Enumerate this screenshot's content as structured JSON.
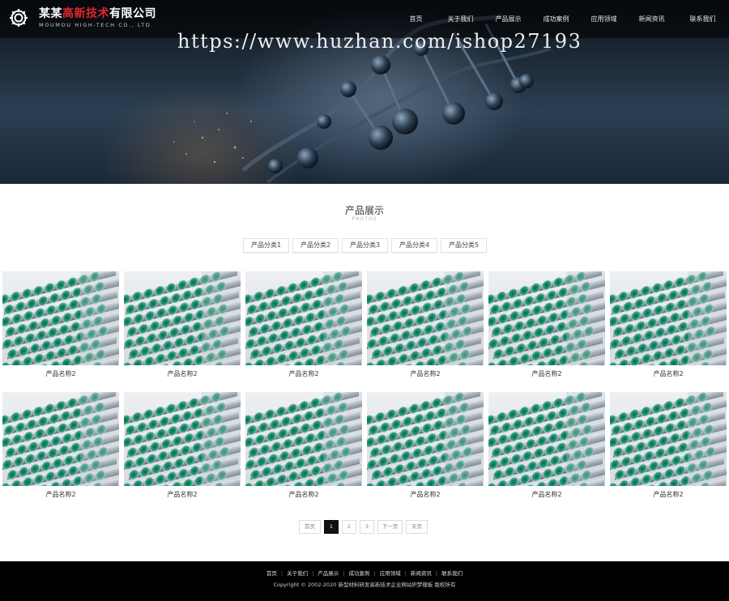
{
  "brand": {
    "name_prefix": "某某",
    "name_highlight": "高新技术",
    "name_suffix": "有限公司",
    "subtitle": "MOUMOU HIGH-TECH CO., LTD.",
    "highlight_color": "#e0262b",
    "logo_icon": "gear-icon"
  },
  "nav": [
    {
      "label": "首页"
    },
    {
      "label": "关于我们"
    },
    {
      "label": "产品展示"
    },
    {
      "label": "成功案例"
    },
    {
      "label": "应用领域"
    },
    {
      "label": "新闻资讯"
    },
    {
      "label": "联系我们"
    }
  ],
  "banner": {
    "watermark": "https://www.huzhan.com/ishop27193"
  },
  "section": {
    "title": "产品展示",
    "subtitle": "PHOTOS"
  },
  "categories": [
    {
      "label": "产品分类1"
    },
    {
      "label": "产品分类2"
    },
    {
      "label": "产品分类3"
    },
    {
      "label": "产品分类4"
    },
    {
      "label": "产品分类5"
    }
  ],
  "products": [
    {
      "name": "产品名称2"
    },
    {
      "name": "产品名称2"
    },
    {
      "name": "产品名称2"
    },
    {
      "name": "产品名称2"
    },
    {
      "name": "产品名称2"
    },
    {
      "name": "产品名称2"
    },
    {
      "name": "产品名称2"
    },
    {
      "name": "产品名称2"
    },
    {
      "name": "产品名称2"
    },
    {
      "name": "产品名称2"
    },
    {
      "name": "产品名称2"
    },
    {
      "name": "产品名称2"
    }
  ],
  "pagination": {
    "first": "首页",
    "pages": [
      "1",
      "2",
      "3"
    ],
    "current": "1",
    "next": "下一页",
    "last": "末页"
  },
  "footer": {
    "links": [
      {
        "label": "首页"
      },
      {
        "label": "关于我们"
      },
      {
        "label": "产品展示"
      },
      {
        "label": "成功案例"
      },
      {
        "label": "应用领域"
      },
      {
        "label": "新闻资讯"
      },
      {
        "label": "联系我们"
      }
    ],
    "copyright": "Copyright © 2002-2020 新型材料研发高新技术企业网站织梦模板 版权所有"
  },
  "colors": {
    "footer_bg": "#000000",
    "active_page": "#111111",
    "pipe_green": "#1e8a6a"
  }
}
